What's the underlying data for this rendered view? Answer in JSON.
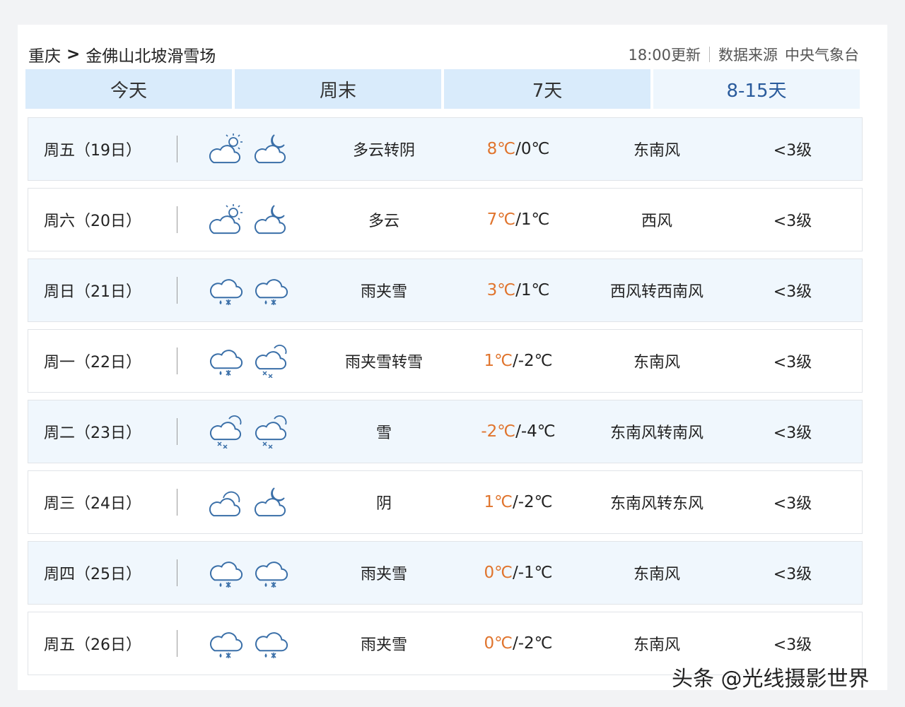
{
  "header": {
    "location_city": "重庆",
    "separator": ">",
    "location_place": "金佛山北坡滑雪场",
    "update_time": "18:00更新",
    "source_label": "数据来源",
    "source_name": "中央气象台"
  },
  "tabs": [
    {
      "label": "今天",
      "active": false
    },
    {
      "label": "周末",
      "active": false
    },
    {
      "label": "7天",
      "active": false
    },
    {
      "label": "8-15天",
      "active": true
    }
  ],
  "forecast": [
    {
      "date": "周五（19日）",
      "day_icon": "partly-cloudy-sun-icon",
      "night_icon": "cloudy-moon-icon",
      "desc": "多云转阴",
      "high": "8℃",
      "low": "0℃",
      "wind": "东南风",
      "level": "<3级"
    },
    {
      "date": "周六（20日）",
      "day_icon": "partly-cloudy-sun-icon",
      "night_icon": "cloudy-moon-icon",
      "desc": "多云",
      "high": "7℃",
      "low": "1℃",
      "wind": "西风",
      "level": "<3级"
    },
    {
      "date": "周日（21日）",
      "day_icon": "sleet-icon",
      "night_icon": "sleet-icon",
      "desc": "雨夹雪",
      "high": "3℃",
      "low": "1℃",
      "wind": "西风转西南风",
      "level": "<3级"
    },
    {
      "date": "周一（22日）",
      "day_icon": "sleet-icon",
      "night_icon": "snow-icon",
      "desc": "雨夹雪转雪",
      "high": "1℃",
      "low": "-2℃",
      "wind": "东南风",
      "level": "<3级"
    },
    {
      "date": "周二（23日）",
      "day_icon": "snow-icon",
      "night_icon": "snow-icon",
      "desc": "雪",
      "high": "-2℃",
      "low": "-4℃",
      "wind": "东南风转南风",
      "level": "<3级"
    },
    {
      "date": "周三（24日）",
      "day_icon": "overcast-icon",
      "night_icon": "cloudy-moon-icon",
      "desc": "阴",
      "high": "1℃",
      "low": "-2℃",
      "wind": "东南风转东风",
      "level": "<3级"
    },
    {
      "date": "周四（25日）",
      "day_icon": "sleet-icon",
      "night_icon": "sleet-icon",
      "desc": "雨夹雪",
      "high": "0℃",
      "low": "-1℃",
      "wind": "东南风",
      "level": "<3级"
    },
    {
      "date": "周五（26日）",
      "day_icon": "sleet-icon",
      "night_icon": "sleet-icon",
      "desc": "雨夹雪",
      "high": "0℃",
      "low": "-2℃",
      "wind": "东南风",
      "level": "<3级"
    }
  ],
  "temp_separator": "/",
  "watermark": "头条 @光线摄影世界",
  "colors": {
    "tab_bg": "#d9ebfb",
    "tab_active_bg": "#eef6fd",
    "tab_active_text": "#2a5b9c",
    "row_shaded_bg": "#f0f7fd",
    "temp_high": "#e0742d",
    "icon_stroke": "#3a6fa8"
  }
}
